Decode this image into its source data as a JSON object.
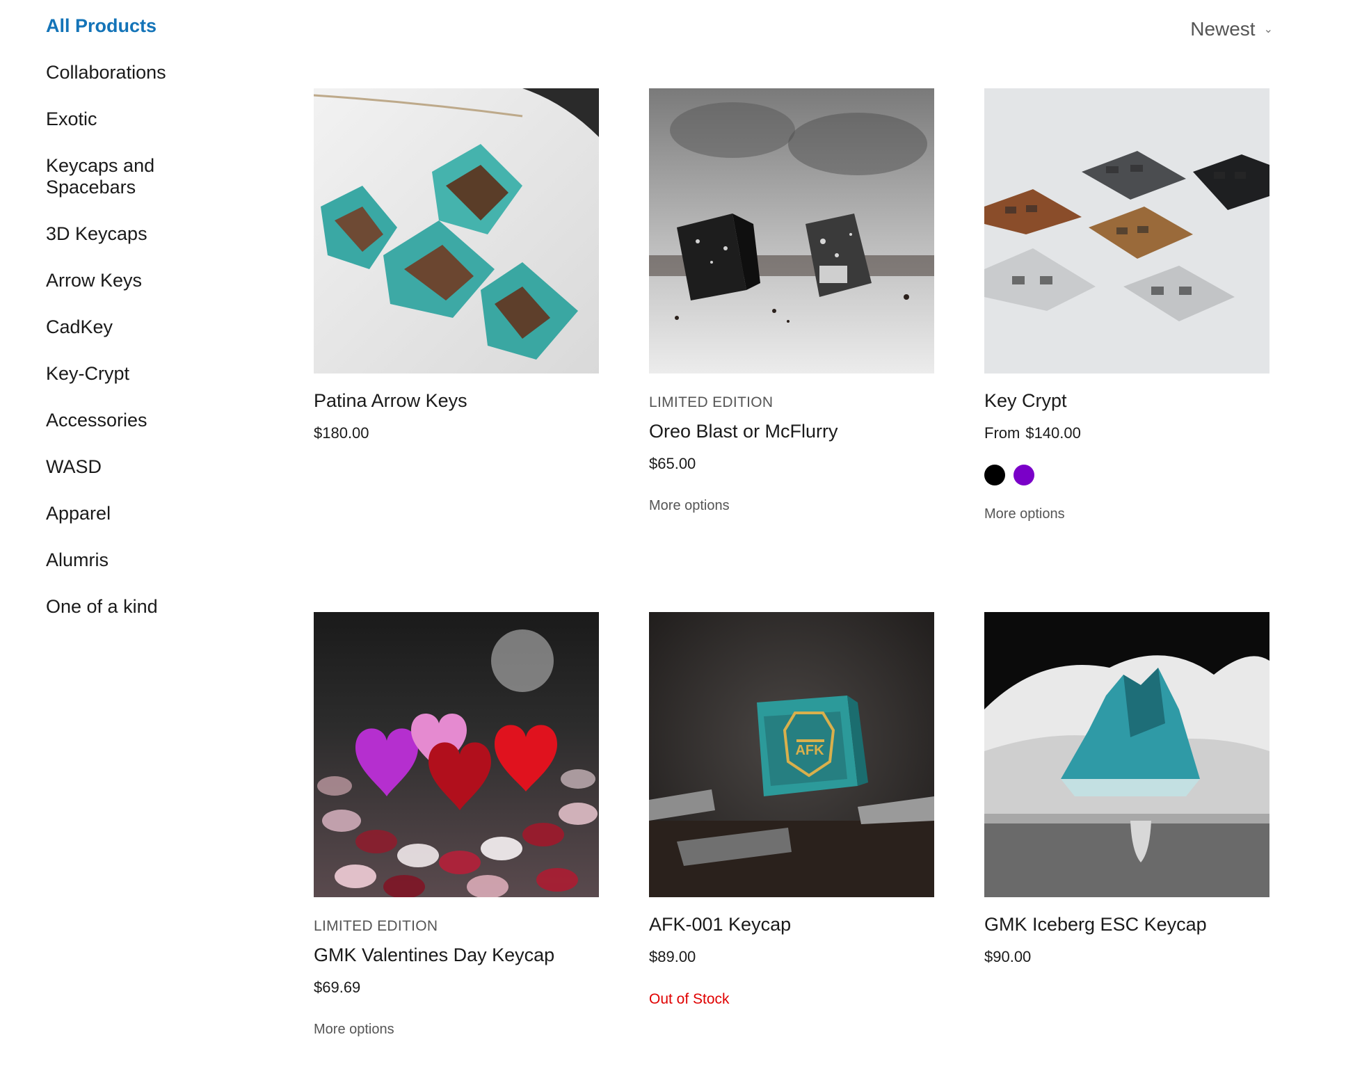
{
  "sidebar": {
    "items": [
      {
        "label": "All Products",
        "active": true
      },
      {
        "label": "Collaborations"
      },
      {
        "label": "Exotic"
      },
      {
        "label": "Keycaps and Spacebars"
      },
      {
        "label": "3D Keycaps"
      },
      {
        "label": "Arrow Keys"
      },
      {
        "label": "CadKey"
      },
      {
        "label": "Key-Crypt"
      },
      {
        "label": "Accessories"
      },
      {
        "label": "WASD"
      },
      {
        "label": "Apparel"
      },
      {
        "label": "Alumris"
      },
      {
        "label": "One of a kind"
      }
    ]
  },
  "sort": {
    "label": "Newest",
    "icon": "chevron-down-icon"
  },
  "products": [
    {
      "name": "Patina Arrow Keys",
      "price": "$180.00"
    },
    {
      "tag": "LIMITED EDITION",
      "name": "Oreo Blast or McFlurry",
      "price": "$65.00",
      "more": "More options"
    },
    {
      "name": "Key Crypt",
      "price_prefix": "From",
      "price": "$140.00",
      "swatches": [
        "#000000",
        "#7a00c8"
      ],
      "more": "More options"
    },
    {
      "tag": "LIMITED EDITION",
      "name": "GMK Valentines Day Keycap",
      "price": "$69.69",
      "more": "More options"
    },
    {
      "name": "AFK-001 Keycap",
      "price": "$89.00",
      "status": "Out of Stock"
    },
    {
      "name": "GMK Iceberg ESC Keycap",
      "price": "$90.00"
    }
  ],
  "colors": {
    "accent": "#1474b8",
    "out_of_stock": "#e00000"
  }
}
